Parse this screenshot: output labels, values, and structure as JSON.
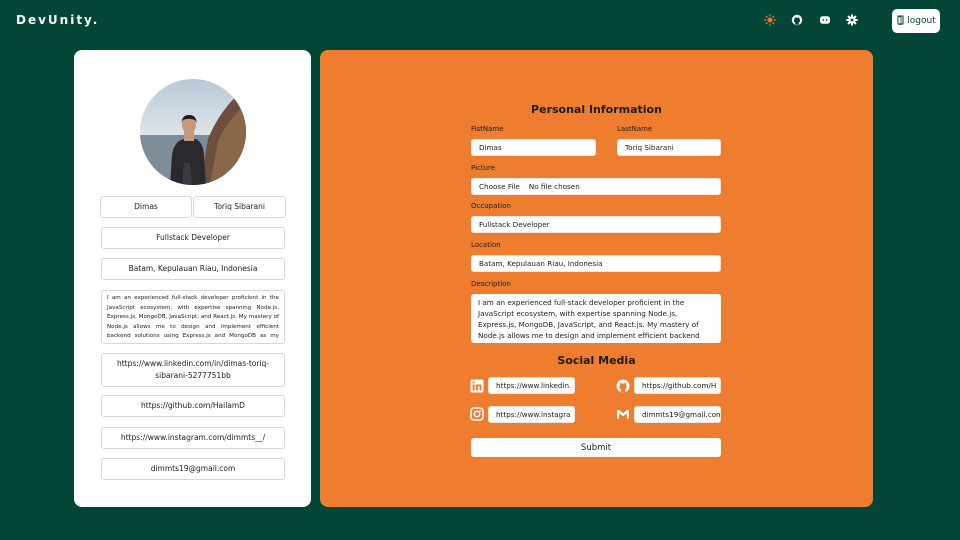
{
  "header": {
    "brand": "DevUnity.",
    "icons": [
      "sun-icon",
      "github-icon",
      "discord-icon",
      "gear-icon"
    ],
    "logout_label": "logout"
  },
  "profile_card": {
    "first_name": "Dimas",
    "last_name": "Toriq Sibarani",
    "occupation": "Fullstack Developer",
    "location": "Batam, Kepulauan Riau, Indonesia",
    "description": "I am an experienced full-stack developer proficient in the JavaScript ecosystem, with expertise spanning Node.js, Express.js, MongoDB, JavaScript, and React.js. My mastery of Node.js allows me to design and implement efficient backend solutions using Express.js and MongoDB as my preferred NoSQL database. In the frontend development, I am skilled in",
    "linkedin": "https://www.linkedin.com/in/dimas-toriq-sibarani-5277751bb",
    "github": "https://github.com/HailamD",
    "instagram": "https://www.instagram.com/dimmts__/",
    "email": "dimmts19@gmail.com"
  },
  "form": {
    "title": "Personal Information",
    "first_name_label": "FistName",
    "first_name_value": "Dimas",
    "last_name_label": "LastName",
    "last_name_value": "Toriq Sibarani",
    "picture_label": "Picture",
    "choose_file_label": "Choose File",
    "no_file_text": "No file chosen",
    "occupation_label": "Occupation",
    "occupation_value": "Fullstack Developer",
    "location_label": "Location",
    "location_value": "Batam, Kepulauan Riau, Indonesia",
    "description_label": "Description",
    "description_value": "I am an experienced full-stack developer proficient in the JavaScript ecosystem, with expertise spanning Node.js, Express.js, MongoDB, JavaScript, and React.js. My mastery of Node.js allows me to design and implement efficient backend solutions using Express.js and MongoDB as my preferred NoSQL database.",
    "social_title": "Social Media",
    "linkedin_value": "https://www.linkedin.",
    "github_value": "https://github.com/H",
    "instagram_value": "https://www.instagra",
    "email_value": "dimmts19@gmail.com",
    "submit_label": "Submit"
  },
  "colors": {
    "background": "#034537",
    "accent": "#ee7d30",
    "card": "#ffffff",
    "sun_icon": "#ee7d30"
  }
}
